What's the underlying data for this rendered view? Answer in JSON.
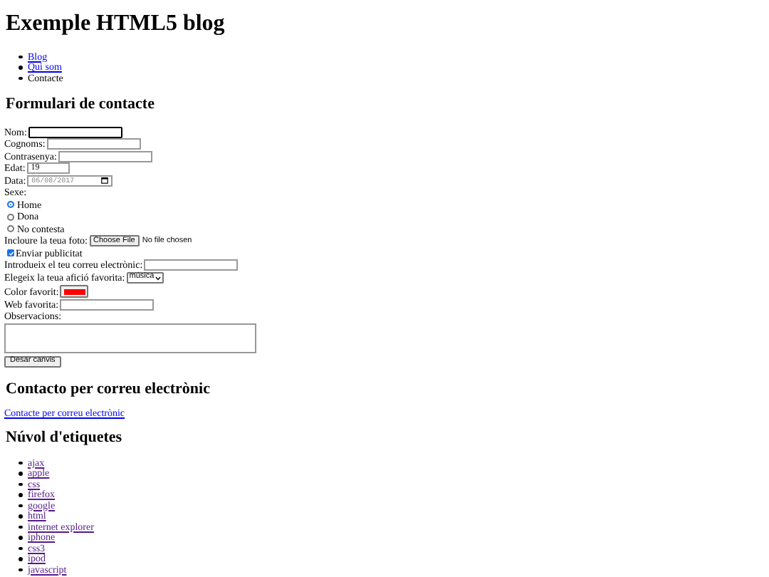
{
  "title": "Exemple HTML5 blog",
  "nav": [
    {
      "label": "Blog",
      "kind": "link"
    },
    {
      "label": "Qui som",
      "kind": "link"
    },
    {
      "label": "Contacte",
      "kind": "text"
    }
  ],
  "form": {
    "heading": "Formulari de contacte",
    "fields": [
      {
        "kind": "text",
        "label": "Nom:",
        "focused": true
      },
      {
        "kind": "text",
        "label": "Cognoms:",
        "focused": false
      },
      {
        "kind": "text",
        "label": "Contrasenya:",
        "focused": false
      },
      {
        "kind": "number",
        "label": "Edat:",
        "value": "19",
        "focused": false
      },
      {
        "kind": "date",
        "label": "Data:",
        "placeholder": "06/08/2017"
      },
      {
        "kind": "label",
        "label": "Sexe:"
      },
      {
        "kind": "radio",
        "label": "Home",
        "selected": true
      },
      {
        "kind": "radio",
        "label": "Dona",
        "selected": false
      },
      {
        "kind": "radio",
        "label": "No contesta",
        "selected": false
      },
      {
        "kind": "file",
        "label": "Incloure la teua foto:",
        "button": "Choose File",
        "status": "No file chosen"
      },
      {
        "kind": "checkbox",
        "label": "Enviar publicitat",
        "checked": true
      },
      {
        "kind": "text",
        "label": "Introdueix el teu correu electrònic:",
        "focused": false
      },
      {
        "kind": "select",
        "label": "Elegeix la teua afició favorita:",
        "value": "música"
      },
      {
        "kind": "color",
        "label": "Color favorit:",
        "color": "#ff0000"
      },
      {
        "kind": "text",
        "label": "Web favorita:",
        "focused": false
      },
      {
        "kind": "textarea",
        "label": "Observacions:"
      }
    ],
    "submit": "Desar canvis"
  },
  "contact": {
    "heading": "Contacto per correu electrònic",
    "link": "Contacte per correu electrònic"
  },
  "tags": {
    "heading": "Núvol d'etiquetes",
    "items": [
      {
        "label": "ajax",
        "visited": true
      },
      {
        "label": "apple",
        "visited": true
      },
      {
        "label": "css",
        "visited": true
      },
      {
        "label": "firefox",
        "visited": true
      },
      {
        "label": "google",
        "visited": true
      },
      {
        "label": "html",
        "visited": true
      },
      {
        "label": "internet explorer",
        "visited": true
      },
      {
        "label": "iphone",
        "visited": true
      },
      {
        "label": "css3",
        "visited": true
      },
      {
        "label": "ipod",
        "visited": true
      },
      {
        "label": "javascript",
        "visited": true
      }
    ]
  }
}
